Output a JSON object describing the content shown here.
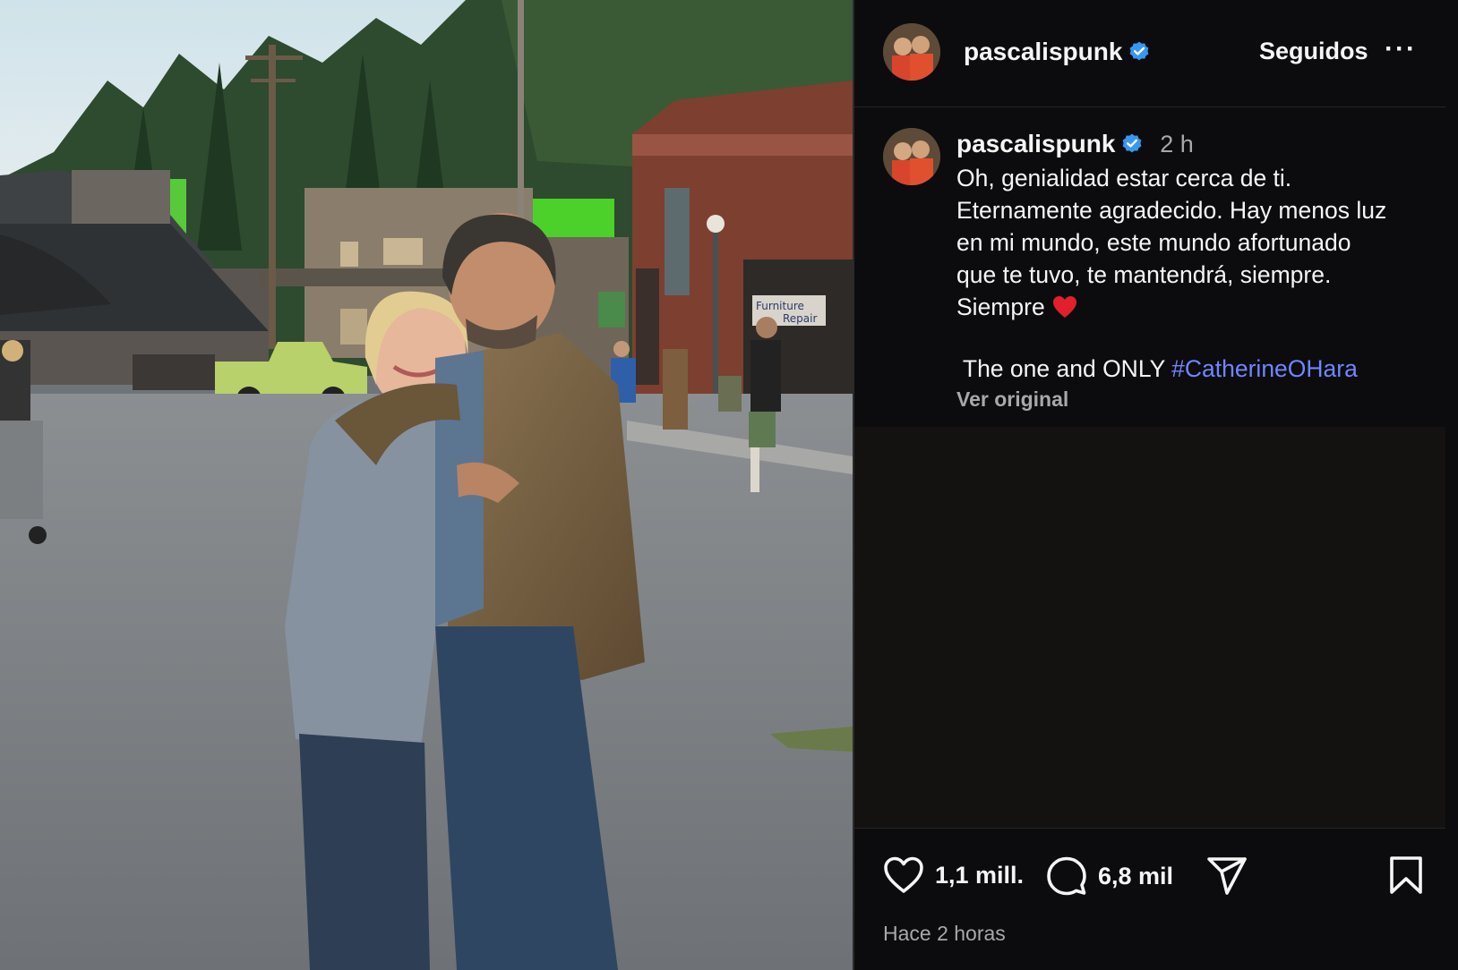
{
  "header": {
    "username": "pascalispunk",
    "follow_state": "Seguidos",
    "more_label": "···"
  },
  "caption": {
    "username": "pascalispunk",
    "time_ago": "2 h",
    "text": "Oh, genialidad estar cerca de ti.\nEternamente agradecido. Hay menos luz\nen mi mundo, este mundo afortunado\nque te tuvo, te mantendrá, siempre.\nSiempre",
    "tagline": " The one and ONLY ",
    "hashtag": "#CatherineOHara",
    "see_original": "Ver original"
  },
  "photo": {
    "sign_line1": "Furniture",
    "sign_line2": "Repair"
  },
  "actions": {
    "likes": "1,1 mill.",
    "comments": "6,8 mil",
    "timestamp": "Hace 2 horas"
  },
  "colors": {
    "background": "#0c0c0e",
    "text": "#f5f5f5",
    "muted": "#a8a8a8",
    "link": "#6e86ff",
    "verified": "#3897f0",
    "heart": "#e0202a"
  },
  "icons": [
    "verified-badge-icon",
    "more-options-icon",
    "heart-icon",
    "comment-icon",
    "share-icon",
    "bookmark-icon",
    "red-heart-emoji"
  ]
}
